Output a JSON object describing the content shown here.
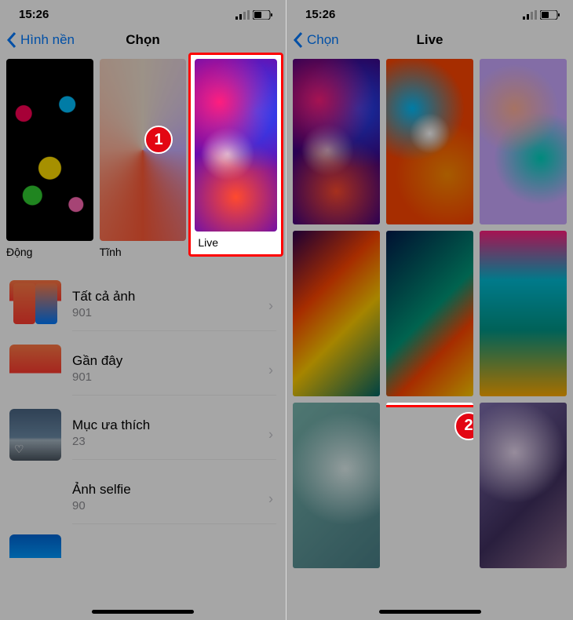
{
  "status": {
    "time": "15:26"
  },
  "left": {
    "back": "Hình nền",
    "title": "Chọn",
    "categories": [
      {
        "label": "Động"
      },
      {
        "label": "Tĩnh"
      },
      {
        "label": "Live"
      }
    ],
    "albums": [
      {
        "title": "Tất cả ảnh",
        "count": "901"
      },
      {
        "title": "Gần đây",
        "count": "901"
      },
      {
        "title": "Mục ưa thích",
        "count": "23"
      },
      {
        "title": "Ảnh selfie",
        "count": "90"
      }
    ],
    "badge": "1"
  },
  "right": {
    "back": "Chọn",
    "title": "Live",
    "badge": "2"
  }
}
